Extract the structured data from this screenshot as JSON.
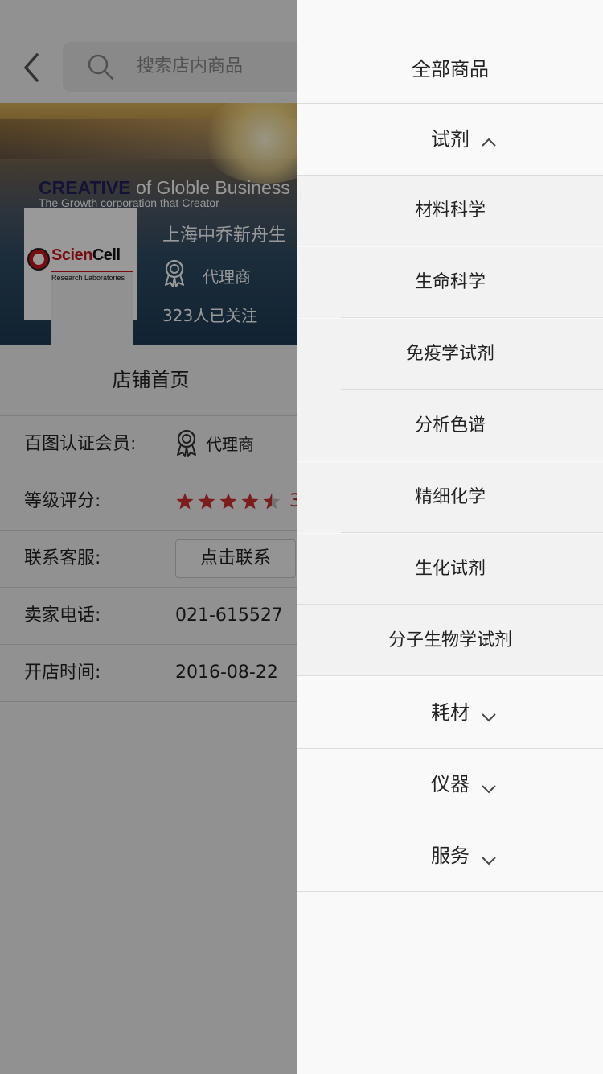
{
  "header": {
    "search_placeholder": "搜索店内商品"
  },
  "shop": {
    "slogan_bold": "CREATIVE",
    "slogan_rest": " of Globle Business",
    "slogan_sub": "The Growth corporation that Creator",
    "logo_brand_a": "Scien",
    "logo_brand_b": "Cell",
    "logo_sub": "Research Laboratories",
    "name": "上海中乔新舟生",
    "type": "代理商",
    "followers": "323人已关注"
  },
  "tabs": {
    "home": "店铺首页"
  },
  "info": {
    "member_label": "百图认证会员:",
    "member_value": "代理商",
    "rating_label": "等级评分:",
    "rating_stars": 4.5,
    "rating_value": "3",
    "contact_label": "联系客服:",
    "contact_button": "点击联系",
    "phone_label": "卖家电话:",
    "phone_value": "021-615527",
    "opened_label": "开店时间:",
    "opened_value": "2016-08-22"
  },
  "drawer": {
    "title": "全部商品",
    "categories": [
      {
        "label": "试剂",
        "expanded": true
      },
      {
        "label": "耗材",
        "expanded": false
      },
      {
        "label": "仪器",
        "expanded": false
      },
      {
        "label": "服务",
        "expanded": false
      }
    ],
    "subcategories": [
      "材料科学",
      "生命科学",
      "免疫学试剂",
      "分析色谱",
      "精细化学",
      "生化试剂",
      "分子生物学试剂"
    ]
  },
  "colors": {
    "star": "#d32f2f",
    "rating_text": "#c62828",
    "logo_red": "#c8161d"
  }
}
